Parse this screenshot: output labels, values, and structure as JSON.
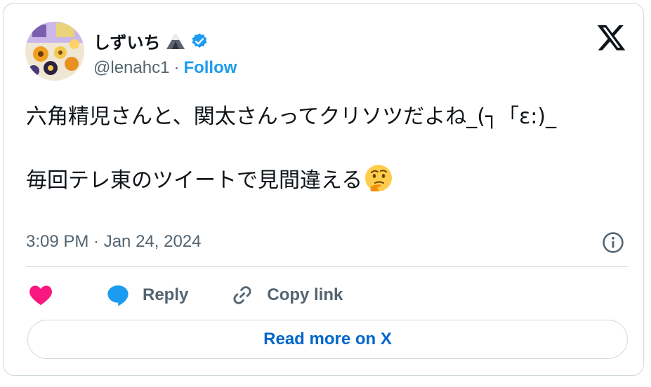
{
  "author": {
    "display_name": "しずいち",
    "handle": "@lenahc1",
    "separator": "·",
    "follow_label": "Follow",
    "verified": true,
    "name_emoji": "mountain-tent-emoji"
  },
  "tweet": {
    "line1": "六角精児さんと、関太さんってクリソツだよね_(┐「ε:)_",
    "line2": "毎回テレ東のツイートで見間違える",
    "line2_emoji": "thinking-face-emoji",
    "timestamp": "3:09 PM · Jan 24, 2024"
  },
  "actions": {
    "reply_label": "Reply",
    "copy_label": "Copy link"
  },
  "read_more_label": "Read more on X",
  "colors": {
    "accent": "#1d9bf0",
    "like": "#f91880",
    "text_primary": "#0f1419",
    "text_secondary": "#536471",
    "border": "#cfd9de",
    "link": "#0066cc"
  },
  "icons": [
    "x-logo-icon",
    "verified-badge-icon",
    "info-icon",
    "heart-icon",
    "reply-bubble-icon",
    "link-icon"
  ]
}
